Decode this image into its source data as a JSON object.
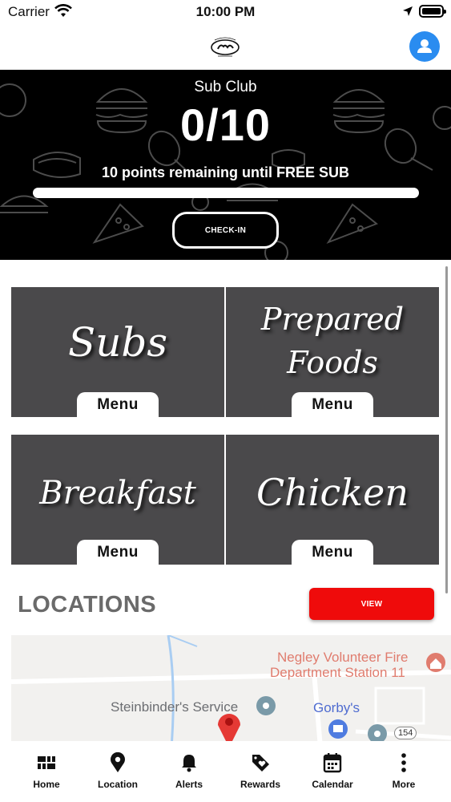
{
  "status_bar": {
    "carrier": "Carrier",
    "time": "10:00 PM"
  },
  "header": {
    "logo_alt": "Gorby's",
    "profile_icon": "user-icon"
  },
  "sub_club": {
    "title": "Sub Club",
    "points_display": "0/10",
    "remaining_text": "10 points remaining until FREE SUB",
    "progress": 0,
    "checkin_label": "CHECK-IN"
  },
  "menu_tiles": [
    {
      "title_line1": "Subs",
      "title_line2": "",
      "button": "Menu"
    },
    {
      "title_line1": "Prepared",
      "title_line2": "Foods",
      "button": "Menu"
    },
    {
      "title_line1": "Breakfast",
      "title_line2": "",
      "button": "Menu"
    },
    {
      "title_line1": "Chicken",
      "title_line2": "",
      "button": "Menu"
    }
  ],
  "locations": {
    "title": "LOCATIONS",
    "view_label": "VIEW"
  },
  "map": {
    "label_fire_1": "Negley Volunteer Fire",
    "label_fire_2": "Department Station 11",
    "label_service": "Steinbinder's Service",
    "label_gorbys": "Gorby's",
    "route_badge": "154"
  },
  "tab_bar": [
    {
      "label": "Home",
      "icon": "home-grid-icon"
    },
    {
      "label": "Location",
      "icon": "map-pin-icon"
    },
    {
      "label": "Alerts",
      "icon": "bell-icon"
    },
    {
      "label": "Rewards",
      "icon": "tag-heart-icon"
    },
    {
      "label": "Calendar",
      "icon": "calendar-icon"
    },
    {
      "label": "More",
      "icon": "more-vertical-icon"
    }
  ],
  "colors": {
    "accent_blue": "#2a8cf0",
    "hero_bg": "#000000",
    "tile_bg": "#4a494b",
    "view_red": "#ef0b0b",
    "locations_gray": "#6a6a6a"
  }
}
